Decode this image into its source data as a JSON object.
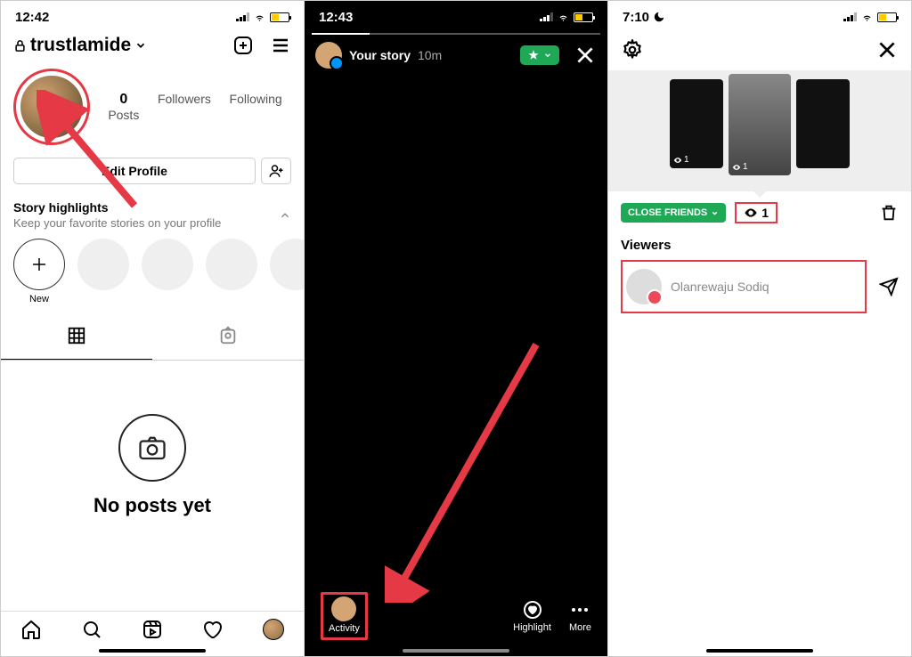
{
  "screen1": {
    "time": "12:42",
    "username": "trustlamide",
    "stats": {
      "posts_num": "0",
      "posts_lbl": "Posts",
      "followers_lbl": "Followers",
      "following_lbl": "Following"
    },
    "edit_profile": "Edit Profile",
    "highlights_title": "Story highlights",
    "highlights_sub": "Keep your favorite stories on your profile",
    "new_lbl": "New",
    "noposts": "No posts yet"
  },
  "screen2": {
    "time": "12:43",
    "title": "Your story",
    "age": "10m",
    "activity_lbl": "Activity",
    "highlight_lbl": "Highlight",
    "more_lbl": "More"
  },
  "screen3": {
    "time": "7:10",
    "cf_label": "CLOSE FRIENDS",
    "view_count": "1",
    "viewers_head": "Viewers",
    "viewer_name": "Olanrewaju Sodiq",
    "thumb_views": "1"
  }
}
